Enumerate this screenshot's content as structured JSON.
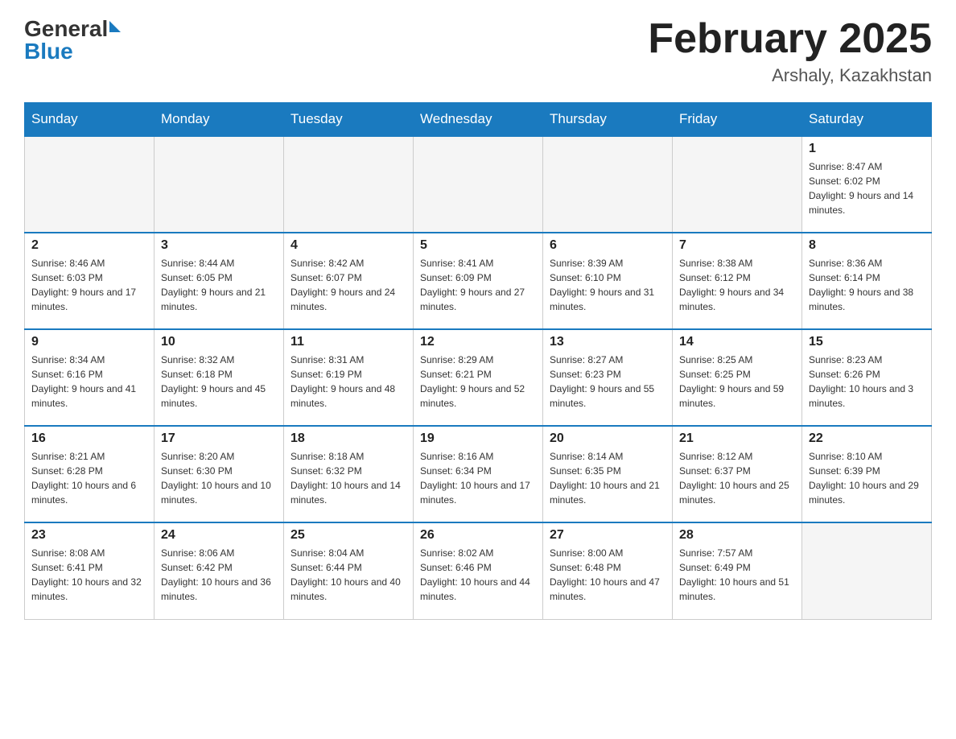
{
  "header": {
    "logo": {
      "general": "General",
      "arrow": "▶",
      "blue": "Blue"
    },
    "title": "February 2025",
    "location": "Arshaly, Kazakhstan"
  },
  "days_of_week": [
    "Sunday",
    "Monday",
    "Tuesday",
    "Wednesday",
    "Thursday",
    "Friday",
    "Saturday"
  ],
  "weeks": [
    {
      "days": [
        {
          "number": "",
          "info": "",
          "empty": true
        },
        {
          "number": "",
          "info": "",
          "empty": true
        },
        {
          "number": "",
          "info": "",
          "empty": true
        },
        {
          "number": "",
          "info": "",
          "empty": true
        },
        {
          "number": "",
          "info": "",
          "empty": true
        },
        {
          "number": "",
          "info": "",
          "empty": true
        },
        {
          "number": "1",
          "sunrise": "Sunrise: 8:47 AM",
          "sunset": "Sunset: 6:02 PM",
          "daylight": "Daylight: 9 hours and 14 minutes.",
          "empty": false
        }
      ]
    },
    {
      "days": [
        {
          "number": "2",
          "sunrise": "Sunrise: 8:46 AM",
          "sunset": "Sunset: 6:03 PM",
          "daylight": "Daylight: 9 hours and 17 minutes.",
          "empty": false
        },
        {
          "number": "3",
          "sunrise": "Sunrise: 8:44 AM",
          "sunset": "Sunset: 6:05 PM",
          "daylight": "Daylight: 9 hours and 21 minutes.",
          "empty": false
        },
        {
          "number": "4",
          "sunrise": "Sunrise: 8:42 AM",
          "sunset": "Sunset: 6:07 PM",
          "daylight": "Daylight: 9 hours and 24 minutes.",
          "empty": false
        },
        {
          "number": "5",
          "sunrise": "Sunrise: 8:41 AM",
          "sunset": "Sunset: 6:09 PM",
          "daylight": "Daylight: 9 hours and 27 minutes.",
          "empty": false
        },
        {
          "number": "6",
          "sunrise": "Sunrise: 8:39 AM",
          "sunset": "Sunset: 6:10 PM",
          "daylight": "Daylight: 9 hours and 31 minutes.",
          "empty": false
        },
        {
          "number": "7",
          "sunrise": "Sunrise: 8:38 AM",
          "sunset": "Sunset: 6:12 PM",
          "daylight": "Daylight: 9 hours and 34 minutes.",
          "empty": false
        },
        {
          "number": "8",
          "sunrise": "Sunrise: 8:36 AM",
          "sunset": "Sunset: 6:14 PM",
          "daylight": "Daylight: 9 hours and 38 minutes.",
          "empty": false
        }
      ]
    },
    {
      "days": [
        {
          "number": "9",
          "sunrise": "Sunrise: 8:34 AM",
          "sunset": "Sunset: 6:16 PM",
          "daylight": "Daylight: 9 hours and 41 minutes.",
          "empty": false
        },
        {
          "number": "10",
          "sunrise": "Sunrise: 8:32 AM",
          "sunset": "Sunset: 6:18 PM",
          "daylight": "Daylight: 9 hours and 45 minutes.",
          "empty": false
        },
        {
          "number": "11",
          "sunrise": "Sunrise: 8:31 AM",
          "sunset": "Sunset: 6:19 PM",
          "daylight": "Daylight: 9 hours and 48 minutes.",
          "empty": false
        },
        {
          "number": "12",
          "sunrise": "Sunrise: 8:29 AM",
          "sunset": "Sunset: 6:21 PM",
          "daylight": "Daylight: 9 hours and 52 minutes.",
          "empty": false
        },
        {
          "number": "13",
          "sunrise": "Sunrise: 8:27 AM",
          "sunset": "Sunset: 6:23 PM",
          "daylight": "Daylight: 9 hours and 55 minutes.",
          "empty": false
        },
        {
          "number": "14",
          "sunrise": "Sunrise: 8:25 AM",
          "sunset": "Sunset: 6:25 PM",
          "daylight": "Daylight: 9 hours and 59 minutes.",
          "empty": false
        },
        {
          "number": "15",
          "sunrise": "Sunrise: 8:23 AM",
          "sunset": "Sunset: 6:26 PM",
          "daylight": "Daylight: 10 hours and 3 minutes.",
          "empty": false
        }
      ]
    },
    {
      "days": [
        {
          "number": "16",
          "sunrise": "Sunrise: 8:21 AM",
          "sunset": "Sunset: 6:28 PM",
          "daylight": "Daylight: 10 hours and 6 minutes.",
          "empty": false
        },
        {
          "number": "17",
          "sunrise": "Sunrise: 8:20 AM",
          "sunset": "Sunset: 6:30 PM",
          "daylight": "Daylight: 10 hours and 10 minutes.",
          "empty": false
        },
        {
          "number": "18",
          "sunrise": "Sunrise: 8:18 AM",
          "sunset": "Sunset: 6:32 PM",
          "daylight": "Daylight: 10 hours and 14 minutes.",
          "empty": false
        },
        {
          "number": "19",
          "sunrise": "Sunrise: 8:16 AM",
          "sunset": "Sunset: 6:34 PM",
          "daylight": "Daylight: 10 hours and 17 minutes.",
          "empty": false
        },
        {
          "number": "20",
          "sunrise": "Sunrise: 8:14 AM",
          "sunset": "Sunset: 6:35 PM",
          "daylight": "Daylight: 10 hours and 21 minutes.",
          "empty": false
        },
        {
          "number": "21",
          "sunrise": "Sunrise: 8:12 AM",
          "sunset": "Sunset: 6:37 PM",
          "daylight": "Daylight: 10 hours and 25 minutes.",
          "empty": false
        },
        {
          "number": "22",
          "sunrise": "Sunrise: 8:10 AM",
          "sunset": "Sunset: 6:39 PM",
          "daylight": "Daylight: 10 hours and 29 minutes.",
          "empty": false
        }
      ]
    },
    {
      "days": [
        {
          "number": "23",
          "sunrise": "Sunrise: 8:08 AM",
          "sunset": "Sunset: 6:41 PM",
          "daylight": "Daylight: 10 hours and 32 minutes.",
          "empty": false
        },
        {
          "number": "24",
          "sunrise": "Sunrise: 8:06 AM",
          "sunset": "Sunset: 6:42 PM",
          "daylight": "Daylight: 10 hours and 36 minutes.",
          "empty": false
        },
        {
          "number": "25",
          "sunrise": "Sunrise: 8:04 AM",
          "sunset": "Sunset: 6:44 PM",
          "daylight": "Daylight: 10 hours and 40 minutes.",
          "empty": false
        },
        {
          "number": "26",
          "sunrise": "Sunrise: 8:02 AM",
          "sunset": "Sunset: 6:46 PM",
          "daylight": "Daylight: 10 hours and 44 minutes.",
          "empty": false
        },
        {
          "number": "27",
          "sunrise": "Sunrise: 8:00 AM",
          "sunset": "Sunset: 6:48 PM",
          "daylight": "Daylight: 10 hours and 47 minutes.",
          "empty": false
        },
        {
          "number": "28",
          "sunrise": "Sunrise: 7:57 AM",
          "sunset": "Sunset: 6:49 PM",
          "daylight": "Daylight: 10 hours and 51 minutes.",
          "empty": false
        },
        {
          "number": "",
          "info": "",
          "empty": true
        }
      ]
    }
  ]
}
